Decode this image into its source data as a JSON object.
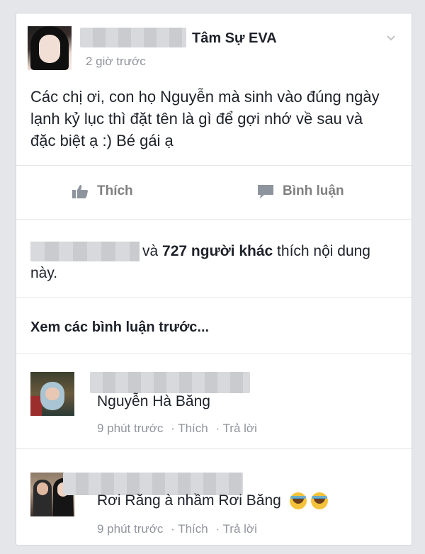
{
  "post": {
    "page_name": "Tâm Sự EVA",
    "timestamp": "2 giờ trước",
    "text": "Các chị ơi, con họ Nguyễn mà sinh vào đúng ngày lạnh kỷ lục thì đặt tên là gì để gợi nhớ về sau và đặc biệt ạ :) Bé gái ạ",
    "menu_icon": "chevron-down-icon"
  },
  "actions": {
    "like_label": "Thích",
    "comment_label": "Bình luận"
  },
  "likes": {
    "and_text": "và ",
    "count_text": "727 người khác",
    "suffix_text": " thích nội dung này."
  },
  "view_previous": "Xem các bình luận trước...",
  "comments": [
    {
      "text": "Nguyễn Hà Băng",
      "time": "9 phút trước",
      "like": "· Thích",
      "reply": "· Trả lời"
    },
    {
      "text": "Rơi Răng à nhầm Rơi Băng",
      "emojis": "😂 😂",
      "time": "9 phút trước",
      "like": "· Thích",
      "reply": "· Trả lời"
    }
  ],
  "colors": {
    "background": "#e4e6ea",
    "text": "#1d2129",
    "secondary": "#90949c",
    "action": "#7f7f7f"
  }
}
